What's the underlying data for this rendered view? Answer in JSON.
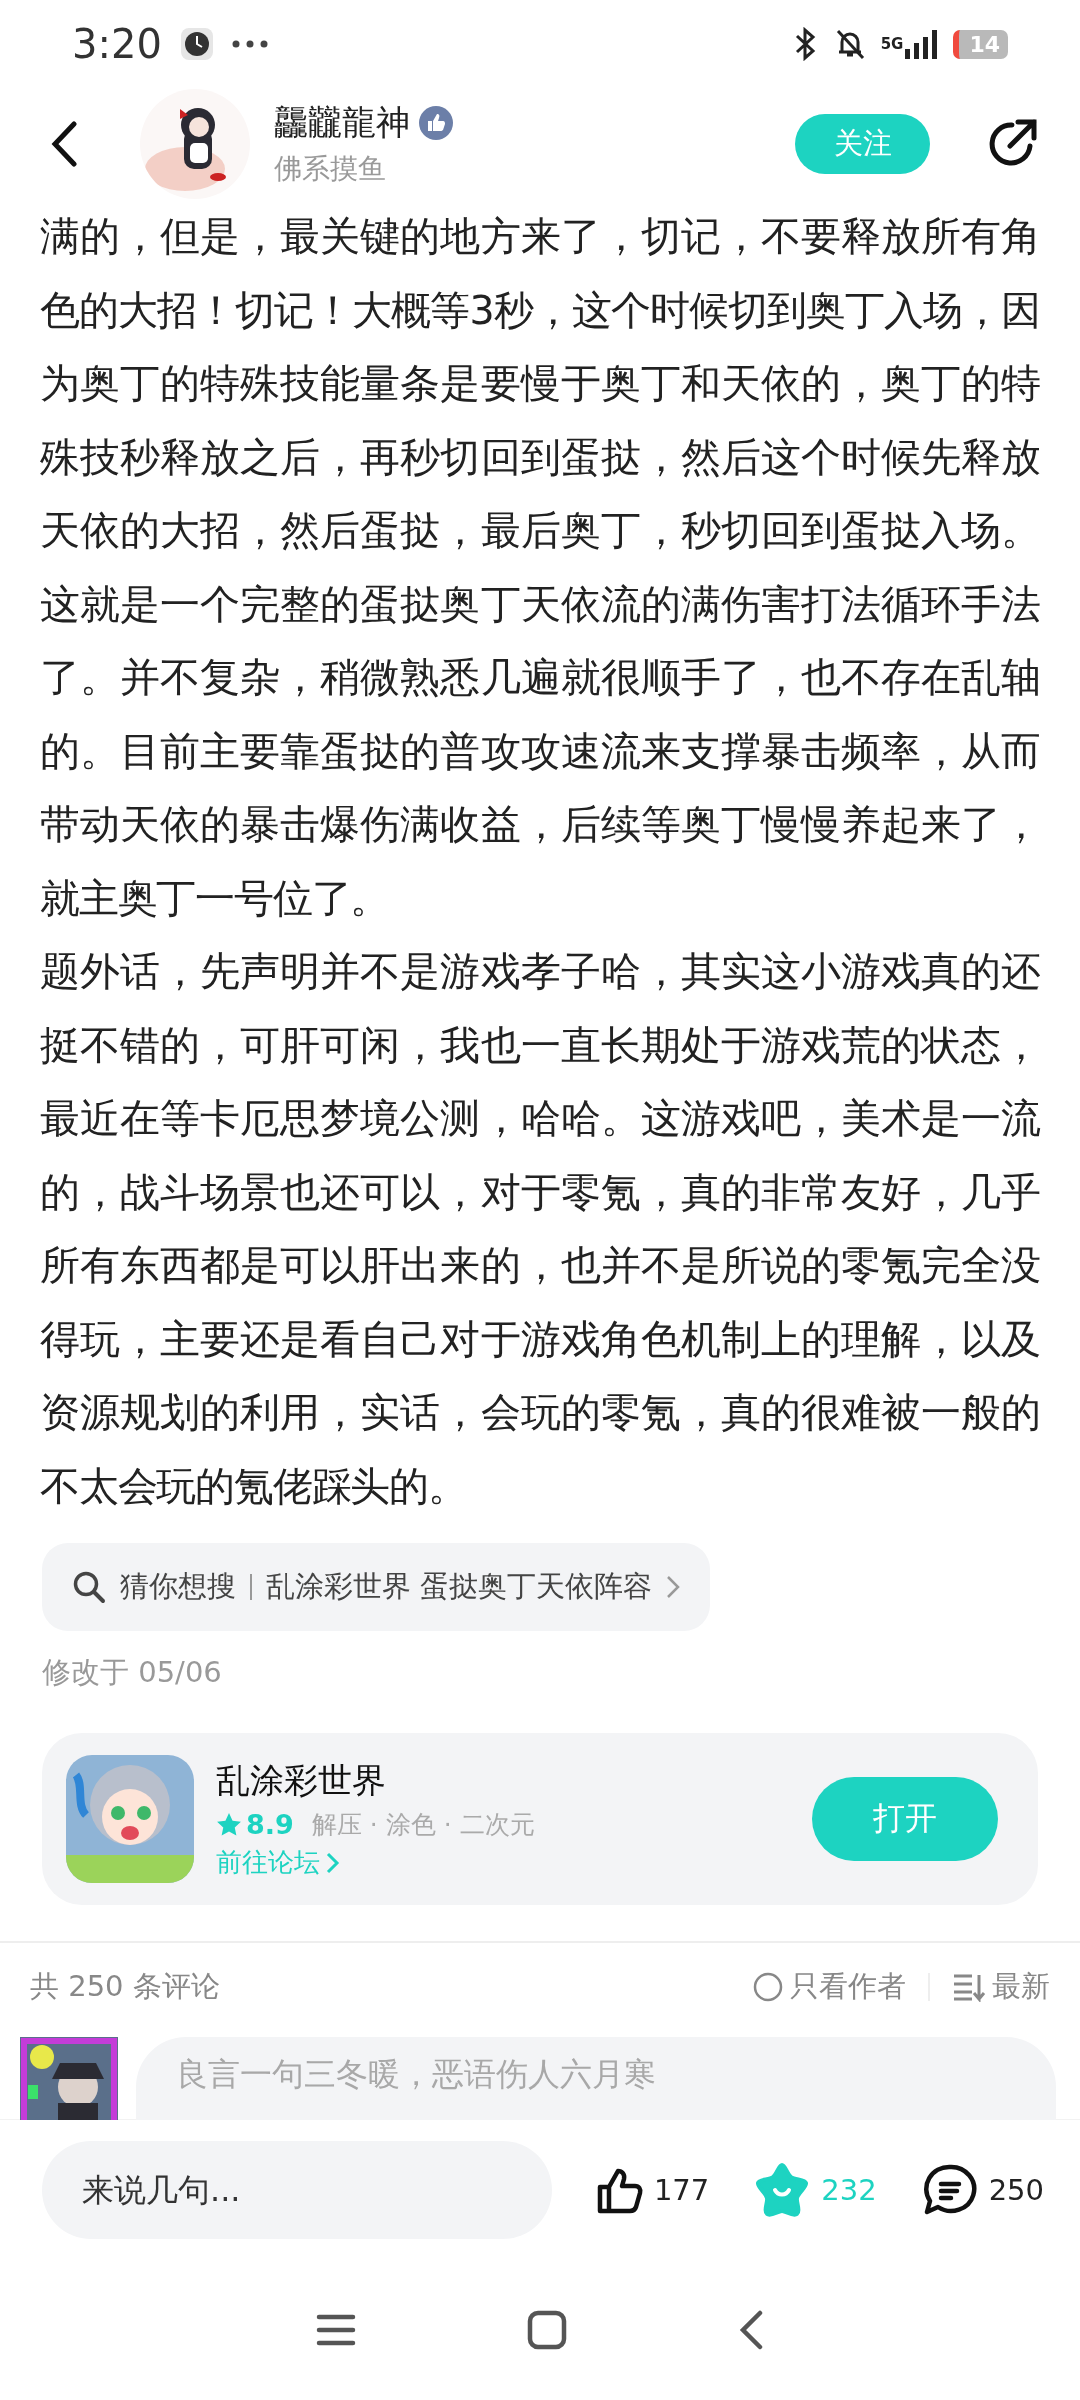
{
  "status_bar": {
    "time": "3:20",
    "network": "5G",
    "battery": "14"
  },
  "header": {
    "author_name": "龘龖龍神",
    "author_subtitle": "佛系摸鱼",
    "follow_button": "关注"
  },
  "article": {
    "paragraphs": [
      "满的，但是，最关键的地方来了，切记，不要释放所有角色的大招！切记！大概等3秒，这个时候切到奥丁入场，因为奥丁的特殊技能量条是要慢于奥丁和天依的，奥丁的特殊技秒释放之后，再秒切回到蛋挞，然后这个时候先释放天依的大招，然后蛋挞，最后奥丁，秒切回到蛋挞入场。这就是一个完整的蛋挞奥丁天依流的满伤害打法循环手法了。并不复杂，稍微熟悉几遍就很顺手了，也不存在乱轴的。目前主要靠蛋挞的普攻攻速流来支撑暴击频率，从而带动天依的暴击爆伤满收益，后续等奥丁慢慢养起来了，就主奥丁一号位了。",
      "题外话，先声明并不是游戏孝子哈，其实这小游戏真的还挺不错的，可肝可闲，我也一直长期处于游戏荒的状态，最近在等卡厄思梦境公测，哈哈。这游戏吧，美术是一流的，战斗场景也还可以，对于零氪，真的非常友好，几乎所有东西都是可以肝出来的，也并不是所说的零氪完全没得玩，主要还是看自己对于游戏角色机制上的理解，以及资源规划的利用，实话，会玩的零氪，真的很难被一般的不太会玩的氪佬踩头的。"
    ]
  },
  "search_suggestion": {
    "prefix": "猜你想搜",
    "query": "乱涂彩世界 蛋挞奥丁天依阵容"
  },
  "modified": "修改于 05/06",
  "game_card": {
    "name": "乱涂彩世界",
    "rating": "8.9",
    "tags": "解压 · 涂色 · 二次元",
    "forum_link": "前往论坛",
    "open_button": "打开"
  },
  "comments": {
    "count_label": "共 250 条评论",
    "author_only": {
      "label": "只看作者",
      "selected": false
    },
    "sort_label": "最新",
    "input_placeholder": "良言一句三冬暖，恶语伤人六月寒"
  },
  "bottom_bar": {
    "input_placeholder": "来说几句...",
    "likes": "177",
    "favorites": "232",
    "favorited": true,
    "comments": "250"
  }
}
